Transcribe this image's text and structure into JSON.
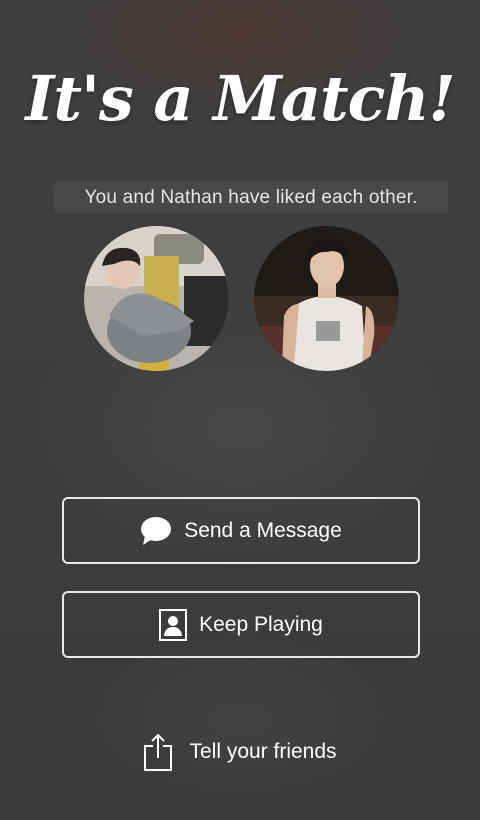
{
  "match": {
    "title": "It's a Match!",
    "subtitle": "You and Nathan have liked each other."
  },
  "avatars": {
    "left": "user-photo",
    "right": "nathan-photo"
  },
  "actions": {
    "send_message": {
      "label": "Send a Message",
      "icon": "chat-bubble-icon"
    },
    "keep_playing": {
      "label": "Keep Playing",
      "icon": "profile-card-icon"
    },
    "tell_friends": {
      "label": "Tell your friends",
      "icon": "share-icon"
    }
  },
  "colors": {
    "background": "#3e3e3e",
    "text": "#ffffff",
    "button_border": "#e8e8e8"
  }
}
